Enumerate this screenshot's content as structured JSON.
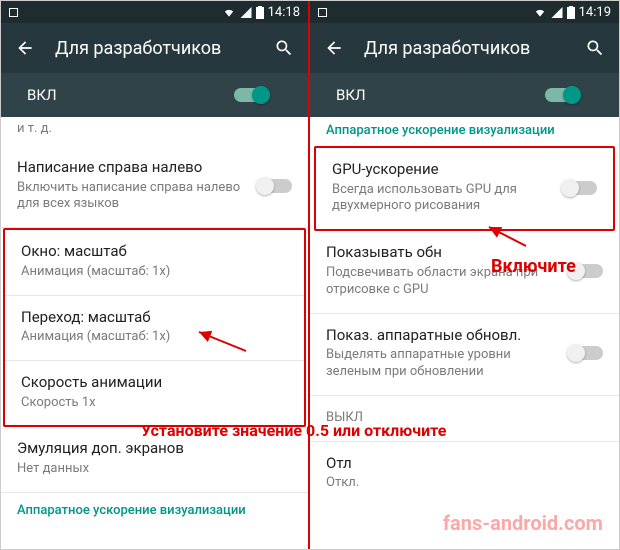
{
  "left": {
    "time": "14:18",
    "appbar_title": "Для разработчиков",
    "master_toggle_label": "ВКЛ",
    "master_toggle_on": true,
    "truncated_top": "и т. д.",
    "rtl": {
      "title": "Написание справа налево",
      "sub": "Включить написание справа налево для всех языков"
    },
    "window_scale": {
      "title": "Окно: масштаб",
      "sub": "Анимация (масштаб: 1x)"
    },
    "transition_scale": {
      "title": "Переход: масштаб",
      "sub": "Анимация (масштаб: 1x)"
    },
    "anim_speed": {
      "title": "Скорость анимации",
      "sub": "Скорость 1x"
    },
    "secondary_display": {
      "title": "Эмуляция доп. экранов",
      "sub": "Нет данных"
    },
    "hw_section": "Аппаратное ускорение визуализации"
  },
  "right": {
    "time": "14:19",
    "appbar_title": "Для разработчиков",
    "master_toggle_label": "ВКЛ",
    "master_toggle_on": true,
    "hw_section": "Аппаратное ускорение визуализации",
    "gpu_accel": {
      "title": "GPU-ускорение",
      "sub": "Всегда использовать GPU для двухмерного рисования"
    },
    "show_updates": {
      "title": "Показывать обн",
      "sub": "Подсвечивать области экрана при отрисовке с GPU"
    },
    "hw_updates": {
      "title": "Показ. аппаратные обновл.",
      "sub": "Выделять аппаратные уровни зеленым при обновлении"
    },
    "partial1": {
      "title": "",
      "sub": "ВЫКЛ"
    },
    "partial2": {
      "title": "Отл",
      "sub": "Откл."
    }
  },
  "annotations": {
    "enable": "Включите",
    "set_value": "Установите значение 0.5 или отключите",
    "watermark": "fans-android.com"
  }
}
